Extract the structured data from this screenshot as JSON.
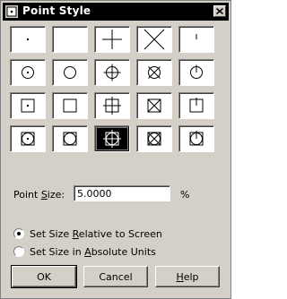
{
  "window": {
    "title": "Point Style",
    "close_icon": "close-x-icon",
    "app_icon": "point-style-app-icon"
  },
  "styles": [
    {
      "id": "dot",
      "label": "dot"
    },
    {
      "id": "none",
      "label": "none"
    },
    {
      "id": "plus",
      "label": "plus"
    },
    {
      "id": "x",
      "label": "x"
    },
    {
      "id": "tick",
      "label": "tick"
    },
    {
      "id": "circle-dot",
      "label": "circle-dot"
    },
    {
      "id": "circle",
      "label": "circle"
    },
    {
      "id": "circle-plus",
      "label": "circle-plus"
    },
    {
      "id": "circle-x",
      "label": "circle-x"
    },
    {
      "id": "circle-tick",
      "label": "circle-tick"
    },
    {
      "id": "square-dot",
      "label": "square-dot"
    },
    {
      "id": "square",
      "label": "square"
    },
    {
      "id": "square-plus",
      "label": "square-plus"
    },
    {
      "id": "square-x",
      "label": "square-x"
    },
    {
      "id": "square-tick",
      "label": "square-tick"
    },
    {
      "id": "square-circle-dot",
      "label": "square-circle-dot"
    },
    {
      "id": "square-circle",
      "label": "square-circle"
    },
    {
      "id": "square-circle-plus",
      "label": "square-circle-plus"
    },
    {
      "id": "square-circle-x",
      "label": "square-circle-x"
    },
    {
      "id": "square-circle-tick",
      "label": "square-circle-tick"
    }
  ],
  "selected_style": "square-circle-plus",
  "point_size": {
    "label_pre": "Point ",
    "label_ul": "S",
    "label_post": "ize:",
    "value": "5.0000",
    "unit": "%"
  },
  "radios": [
    {
      "pre": "Set Size ",
      "ul": "R",
      "post": "elative to Screen",
      "checked": true
    },
    {
      "pre": "Set Size in ",
      "ul": "A",
      "post": "bsolute Units",
      "checked": false
    }
  ],
  "buttons": {
    "ok": "OK",
    "cancel": "Cancel",
    "help_ul": "H",
    "help_post": "elp"
  }
}
